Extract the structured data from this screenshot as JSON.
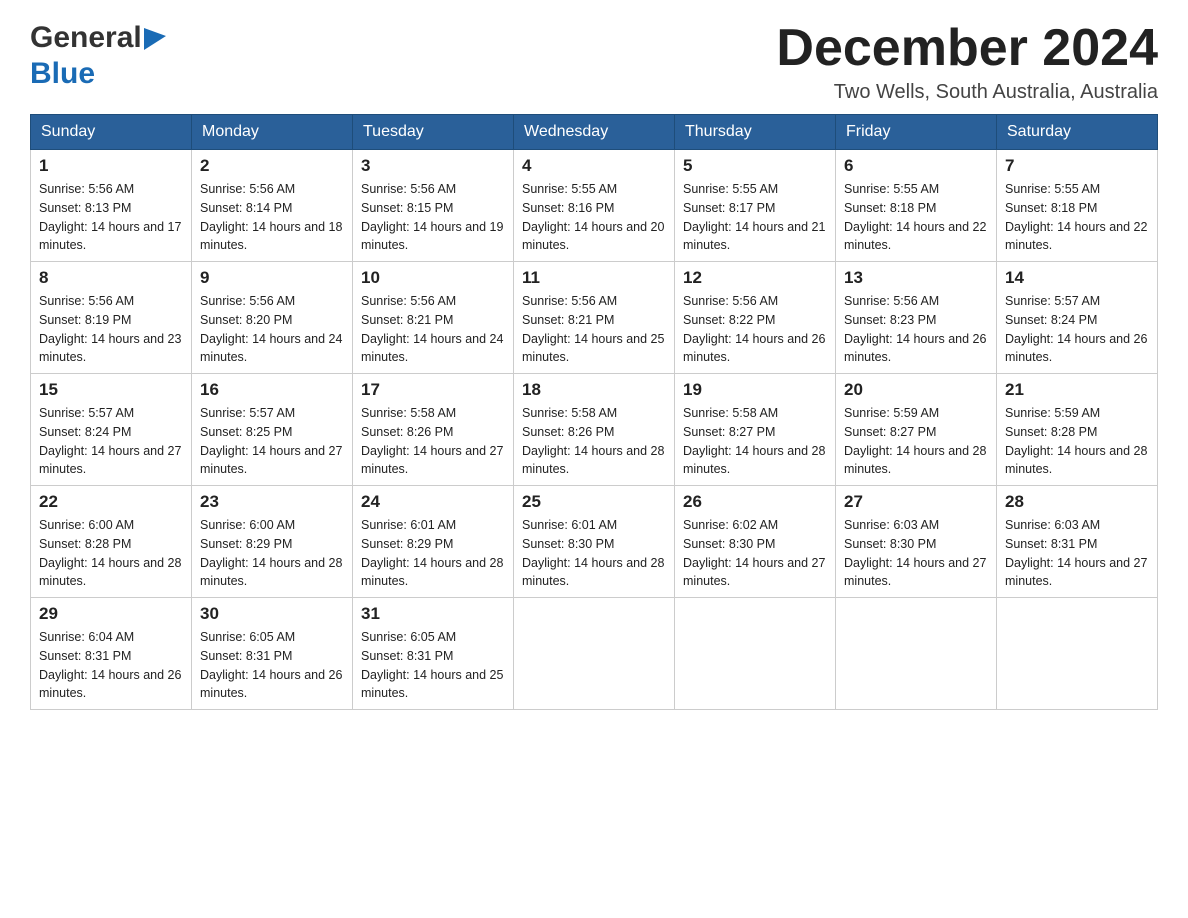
{
  "logo": {
    "line1": "General",
    "line2": "Blue"
  },
  "title": "December 2024",
  "subtitle": "Two Wells, South Australia, Australia",
  "weekdays": [
    "Sunday",
    "Monday",
    "Tuesday",
    "Wednesday",
    "Thursday",
    "Friday",
    "Saturday"
  ],
  "weeks": [
    [
      {
        "day": "1",
        "sunrise": "5:56 AM",
        "sunset": "8:13 PM",
        "daylight": "14 hours and 17 minutes."
      },
      {
        "day": "2",
        "sunrise": "5:56 AM",
        "sunset": "8:14 PM",
        "daylight": "14 hours and 18 minutes."
      },
      {
        "day": "3",
        "sunrise": "5:56 AM",
        "sunset": "8:15 PM",
        "daylight": "14 hours and 19 minutes."
      },
      {
        "day": "4",
        "sunrise": "5:55 AM",
        "sunset": "8:16 PM",
        "daylight": "14 hours and 20 minutes."
      },
      {
        "day": "5",
        "sunrise": "5:55 AM",
        "sunset": "8:17 PM",
        "daylight": "14 hours and 21 minutes."
      },
      {
        "day": "6",
        "sunrise": "5:55 AM",
        "sunset": "8:18 PM",
        "daylight": "14 hours and 22 minutes."
      },
      {
        "day": "7",
        "sunrise": "5:55 AM",
        "sunset": "8:18 PM",
        "daylight": "14 hours and 22 minutes."
      }
    ],
    [
      {
        "day": "8",
        "sunrise": "5:56 AM",
        "sunset": "8:19 PM",
        "daylight": "14 hours and 23 minutes."
      },
      {
        "day": "9",
        "sunrise": "5:56 AM",
        "sunset": "8:20 PM",
        "daylight": "14 hours and 24 minutes."
      },
      {
        "day": "10",
        "sunrise": "5:56 AM",
        "sunset": "8:21 PM",
        "daylight": "14 hours and 24 minutes."
      },
      {
        "day": "11",
        "sunrise": "5:56 AM",
        "sunset": "8:21 PM",
        "daylight": "14 hours and 25 minutes."
      },
      {
        "day": "12",
        "sunrise": "5:56 AM",
        "sunset": "8:22 PM",
        "daylight": "14 hours and 26 minutes."
      },
      {
        "day": "13",
        "sunrise": "5:56 AM",
        "sunset": "8:23 PM",
        "daylight": "14 hours and 26 minutes."
      },
      {
        "day": "14",
        "sunrise": "5:57 AM",
        "sunset": "8:24 PM",
        "daylight": "14 hours and 26 minutes."
      }
    ],
    [
      {
        "day": "15",
        "sunrise": "5:57 AM",
        "sunset": "8:24 PM",
        "daylight": "14 hours and 27 minutes."
      },
      {
        "day": "16",
        "sunrise": "5:57 AM",
        "sunset": "8:25 PM",
        "daylight": "14 hours and 27 minutes."
      },
      {
        "day": "17",
        "sunrise": "5:58 AM",
        "sunset": "8:26 PM",
        "daylight": "14 hours and 27 minutes."
      },
      {
        "day": "18",
        "sunrise": "5:58 AM",
        "sunset": "8:26 PM",
        "daylight": "14 hours and 28 minutes."
      },
      {
        "day": "19",
        "sunrise": "5:58 AM",
        "sunset": "8:27 PM",
        "daylight": "14 hours and 28 minutes."
      },
      {
        "day": "20",
        "sunrise": "5:59 AM",
        "sunset": "8:27 PM",
        "daylight": "14 hours and 28 minutes."
      },
      {
        "day": "21",
        "sunrise": "5:59 AM",
        "sunset": "8:28 PM",
        "daylight": "14 hours and 28 minutes."
      }
    ],
    [
      {
        "day": "22",
        "sunrise": "6:00 AM",
        "sunset": "8:28 PM",
        "daylight": "14 hours and 28 minutes."
      },
      {
        "day": "23",
        "sunrise": "6:00 AM",
        "sunset": "8:29 PM",
        "daylight": "14 hours and 28 minutes."
      },
      {
        "day": "24",
        "sunrise": "6:01 AM",
        "sunset": "8:29 PM",
        "daylight": "14 hours and 28 minutes."
      },
      {
        "day": "25",
        "sunrise": "6:01 AM",
        "sunset": "8:30 PM",
        "daylight": "14 hours and 28 minutes."
      },
      {
        "day": "26",
        "sunrise": "6:02 AM",
        "sunset": "8:30 PM",
        "daylight": "14 hours and 27 minutes."
      },
      {
        "day": "27",
        "sunrise": "6:03 AM",
        "sunset": "8:30 PM",
        "daylight": "14 hours and 27 minutes."
      },
      {
        "day": "28",
        "sunrise": "6:03 AM",
        "sunset": "8:31 PM",
        "daylight": "14 hours and 27 minutes."
      }
    ],
    [
      {
        "day": "29",
        "sunrise": "6:04 AM",
        "sunset": "8:31 PM",
        "daylight": "14 hours and 26 minutes."
      },
      {
        "day": "30",
        "sunrise": "6:05 AM",
        "sunset": "8:31 PM",
        "daylight": "14 hours and 26 minutes."
      },
      {
        "day": "31",
        "sunrise": "6:05 AM",
        "sunset": "8:31 PM",
        "daylight": "14 hours and 25 minutes."
      },
      null,
      null,
      null,
      null
    ]
  ],
  "labels": {
    "sunrise": "Sunrise:",
    "sunset": "Sunset:",
    "daylight": "Daylight:"
  }
}
